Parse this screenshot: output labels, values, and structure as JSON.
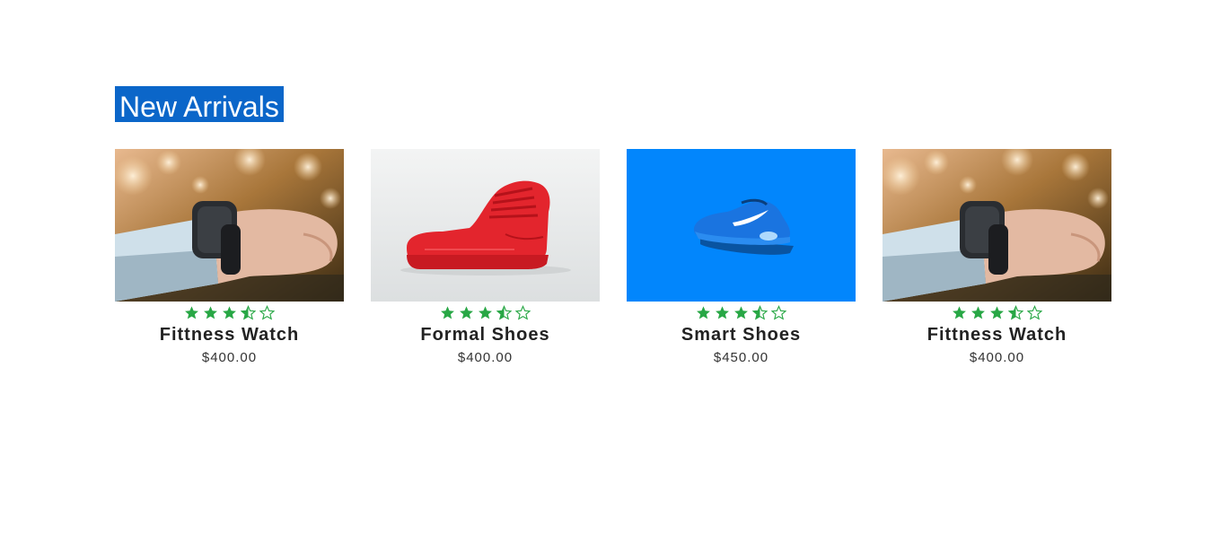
{
  "section": {
    "title": "New Arrivals",
    "title_bg": "#0b66c9"
  },
  "products": [
    {
      "name": "Fittness Watch",
      "price": "$400.00",
      "rating": 3.5,
      "rating_max": 5,
      "image_icon": "wrist-smartwatch-photo"
    },
    {
      "name": "Formal Shoes",
      "price": "$400.00",
      "rating": 3.5,
      "rating_max": 5,
      "image_icon": "red-high-top-sneaker-photo"
    },
    {
      "name": "Smart Shoes",
      "price": "$450.00",
      "rating": 3.5,
      "rating_max": 5,
      "image_icon": "blue-running-shoe-photo"
    },
    {
      "name": "Fittness Watch",
      "price": "$400.00",
      "rating": 3.5,
      "rating_max": 5,
      "image_icon": "wrist-smartwatch-photo"
    }
  ],
  "colors": {
    "star": "#28a745",
    "name": "#222222",
    "price": "#333333",
    "blue_background": "#0286fc"
  }
}
